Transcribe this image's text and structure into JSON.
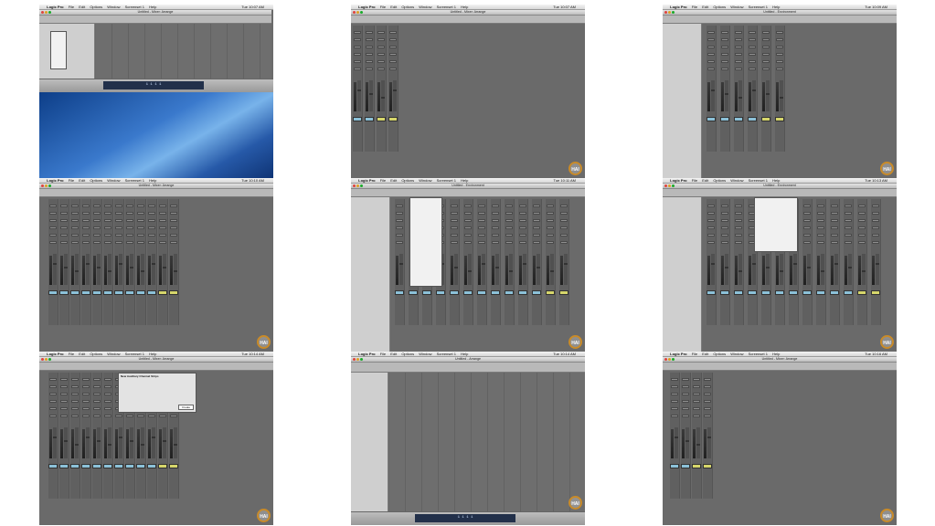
{
  "menu": {
    "app": "Logic Pro",
    "items": [
      "File",
      "Edit",
      "Options",
      "Window",
      "Screenset 1",
      "Help"
    ]
  },
  "frames": [
    {
      "clock": "Tue 10:07 AM",
      "title": "Untitled - Mixer: Arrange"
    },
    {
      "clock": "Tue 10:07 AM",
      "title": "Untitled - Mixer: Arrange"
    },
    {
      "clock": "Tue 10:09 AM",
      "title": "Untitled - Environment"
    },
    {
      "clock": "Tue 10:10 AM",
      "title": "Untitled - Mixer: Arrange"
    },
    {
      "clock": "Tue 10:11 AM",
      "title": "Untitled - Environment"
    },
    {
      "clock": "Tue 10:13 AM",
      "title": "Untitled - Environment"
    },
    {
      "clock": "Tue 10:14 AM",
      "title": "Untitled - Mixer: Arrange"
    },
    {
      "clock": "Tue 10:14 AM",
      "title": "Untitled - Arrange"
    },
    {
      "clock": "Tue 10:16 AM",
      "title": "Untitled - Mixer: Arrange"
    }
  ],
  "watermark": "HAI",
  "dialog": {
    "title": "New Auxiliary Channel Strips",
    "button": "Create"
  },
  "transport_readout": "1 1 1 1"
}
